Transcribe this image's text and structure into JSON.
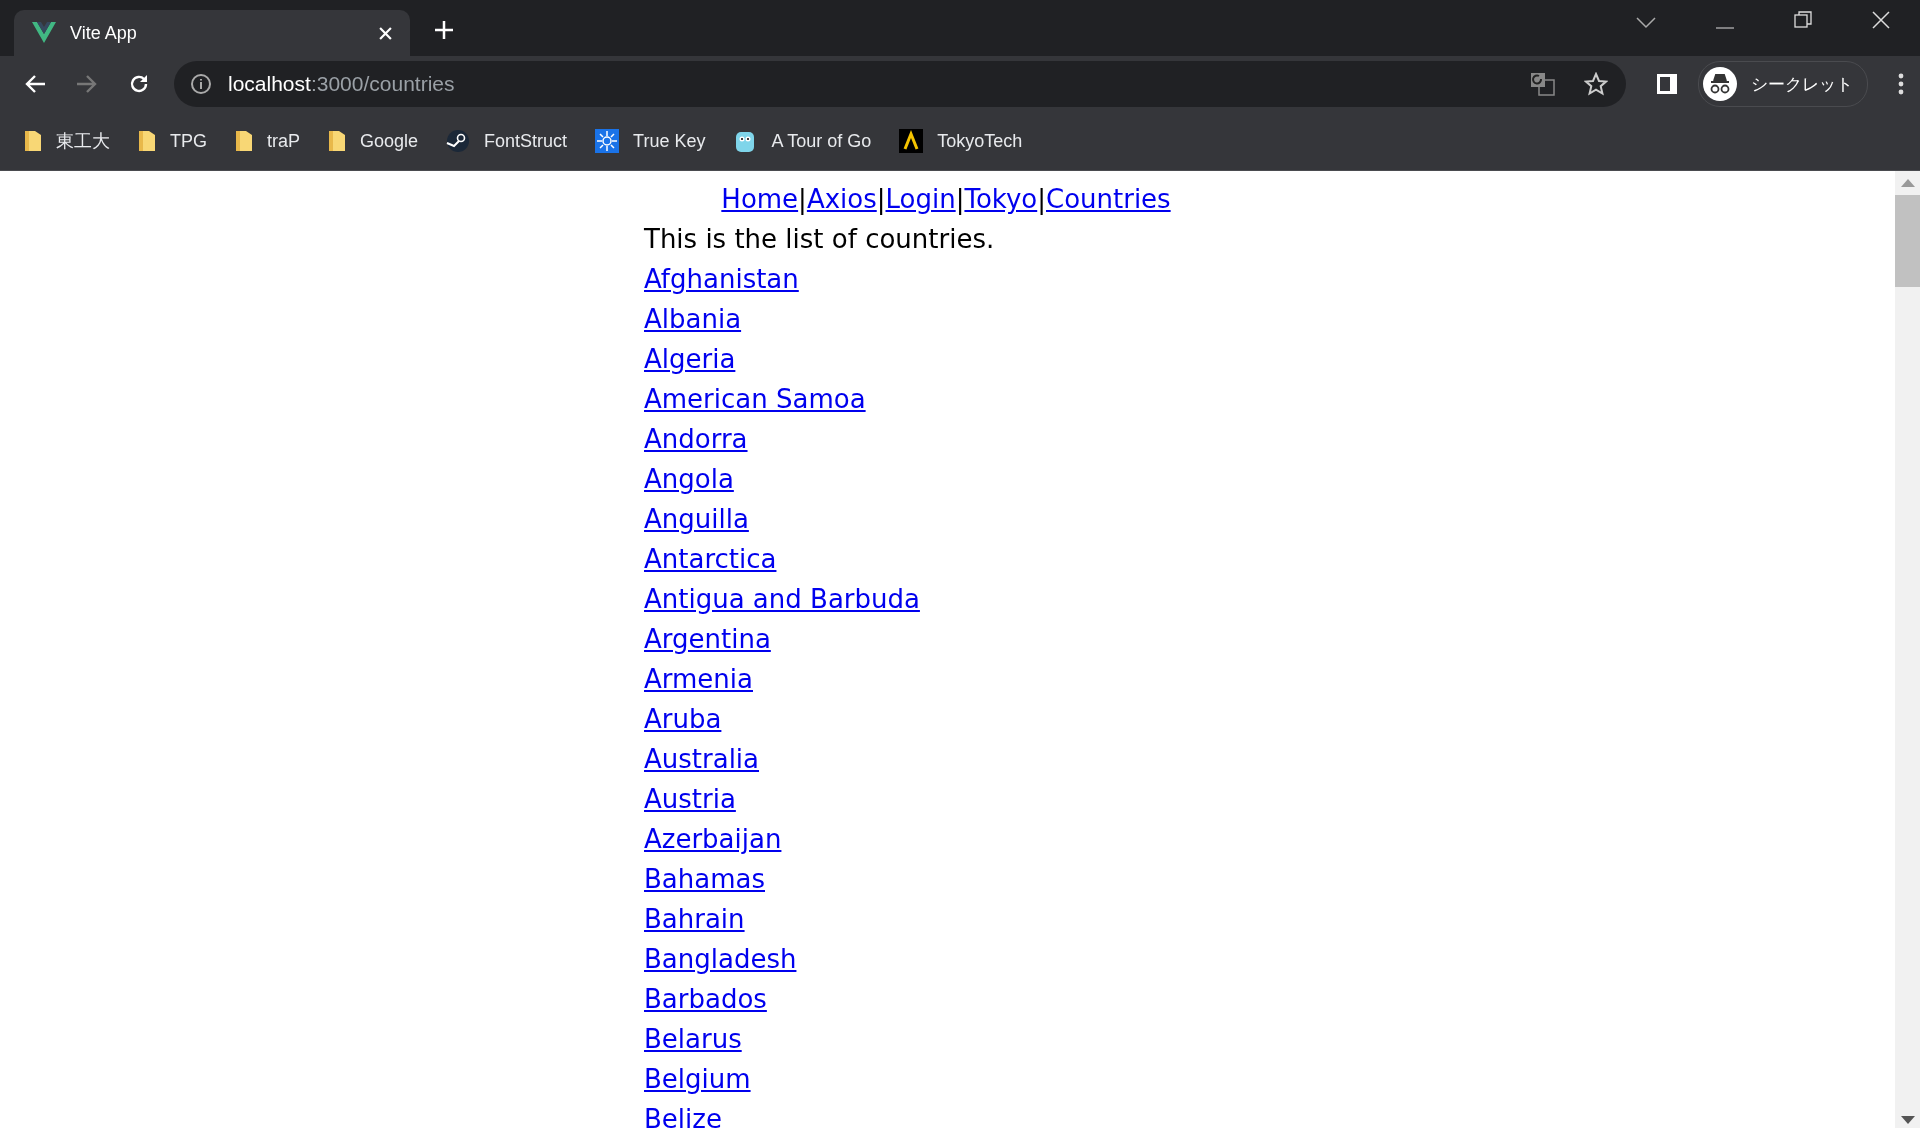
{
  "browser": {
    "tab": {
      "title": "Vite App",
      "selected": true
    },
    "address": {
      "host": "localhost",
      "path": ":3000/countries"
    },
    "profile": "シークレット",
    "bookmarks": [
      {
        "kind": "folder",
        "label": "東工大"
      },
      {
        "kind": "folder",
        "label": "TPG"
      },
      {
        "kind": "folder",
        "label": "traP"
      },
      {
        "kind": "folder",
        "label": "Google"
      },
      {
        "kind": "steam",
        "label": "FontStruct"
      },
      {
        "kind": "truekey",
        "label": "True Key"
      },
      {
        "kind": "gopher",
        "label": "A Tour of Go"
      },
      {
        "kind": "lambda",
        "label": "TokyoTech"
      }
    ]
  },
  "page": {
    "nav": [
      "Home",
      "Axios",
      "Login",
      "Tokyo",
      "Countries"
    ],
    "nav_separator": "|",
    "intro": "This is the list of countries.",
    "countries": [
      "Afghanistan",
      "Albania",
      "Algeria",
      "American Samoa",
      "Andorra",
      "Angola",
      "Anguilla",
      "Antarctica",
      "Antigua and Barbuda",
      "Argentina",
      "Armenia",
      "Aruba",
      "Australia",
      "Austria",
      "Azerbaijan",
      "Bahamas",
      "Bahrain",
      "Bangladesh",
      "Barbados",
      "Belarus",
      "Belgium",
      "Belize"
    ]
  }
}
